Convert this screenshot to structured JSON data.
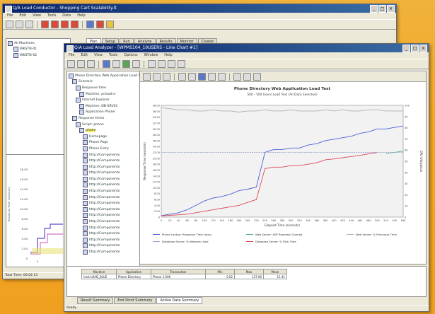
{
  "back_window": {
    "title": "Q/A Load Conductor - Shopping Cart Scalability.lt",
    "menu": [
      "File",
      "Edit",
      "View",
      "Tools",
      "Data",
      "Help"
    ],
    "tabs": [
      "Plan",
      "Setup",
      "Run",
      "Analyze",
      "Results",
      "Monitor",
      "Cluster"
    ],
    "tree": [
      "All Machines",
      "WKSTN-01",
      "WKSTN-02"
    ],
    "stats_label": "Total Time: 00:02:13",
    "mini_chart": {
      "ylabel": "Response Time (seconds)",
      "yticks": [
        "18.00",
        "16.00",
        "14.00",
        "12.00",
        "10.00",
        "8.00",
        "6.00",
        "4.00",
        "2.00",
        "0"
      ],
      "xtick": "0"
    }
  },
  "front_window": {
    "title": "Q/A Load Analyzer - [WPMS104_10USERS - Line Chart #1]",
    "menu": [
      "File",
      "Edit",
      "View",
      "Tools",
      "Options",
      "Window",
      "Help"
    ],
    "tree": [
      "Phone Directory Web Application Load Test",
      "Scenario",
      "Response time",
      "Machine: pcload-a",
      "Internet Explorer",
      "Machine: DB-SRV01",
      "Application Phone",
      "Response times",
      "Script: phone",
      "phone",
      "Homepage",
      "Phone Page",
      "Phone Entry",
      "http://Componentx",
      "http://Componentx",
      "http://Componentx",
      "http://Componentx",
      "http://Componentx",
      "http://Componentx",
      "http://Componentx",
      "http://Componentx",
      "http://Componentx",
      "http://Componentx",
      "http://Componentx",
      "http://Componentx",
      "http://Componentx",
      "http://Componentx",
      "http://Componentx",
      "http://Componentx",
      "http://Componentx"
    ],
    "bottom_tabs": [
      "Result Summary",
      "End Point Summary",
      "Active Data Summary"
    ],
    "table": {
      "headers": [
        "Machine",
        "Application",
        "Transaction",
        "Min",
        "Max",
        "Mean"
      ],
      "rows": [
        [
          "host-LOAD_BLUE",
          "Phone Directory",
          "Phone 1:500",
          "0.02",
          "137.06",
          "11.41"
        ]
      ]
    },
    "status": "Ready"
  },
  "chart_data": {
    "type": "line",
    "title": "Phone Directory Web Application Load Test",
    "subtitle": "500 - 500 Users Load Test (All Data Selected)",
    "xlabel": "Elapsed Time (seconds)",
    "ylabel": "Response Time (seconds)",
    "y2label": "CPU Utilization",
    "x": [
      0,
      20,
      40,
      60,
      80,
      100,
      120,
      140,
      160,
      180,
      200,
      220,
      240,
      260,
      280,
      300,
      320,
      340,
      360,
      380,
      400,
      420,
      440,
      460,
      480,
      500,
      520,
      540,
      560
    ],
    "ylim": [
      0,
      38
    ],
    "y2lim": [
      0,
      100
    ],
    "yticks": [
      "38.00",
      "36.00",
      "34.00",
      "32.00",
      "30.00",
      "28.00",
      "26.00",
      "24.00",
      "22.00",
      "20.00",
      "18.00",
      "16.00",
      "14.00",
      "12.00",
      "10.00",
      "8.00",
      "6.00",
      "4.00",
      "2.00",
      "0"
    ],
    "y2ticks": [
      "100",
      "90",
      "80",
      "70",
      "60",
      "50",
      "40",
      "30",
      "20",
      "10",
      "0"
    ],
    "xticks": [
      "0",
      "20",
      "40",
      "60",
      "80",
      "100",
      "120",
      "140",
      "160",
      "180",
      "200",
      "220",
      "240",
      "260",
      "280",
      "300",
      "320",
      "340",
      "360",
      "380",
      "400",
      "420",
      "440",
      "460",
      "480",
      "500",
      "520",
      "540",
      "560"
    ],
    "series": [
      {
        "name": "Phone Lookup: Response Time (secs)",
        "color": "#4a5fd6",
        "axis": "left",
        "values": [
          0.5,
          1.0,
          1.5,
          2.5,
          4.0,
          5.5,
          6.5,
          7.0,
          7.8,
          9.0,
          9.5,
          10.2,
          22.0,
          23.0,
          23.0,
          23.5,
          23.5,
          24.5,
          25.0,
          26.0,
          26.5,
          27.0,
          27.5,
          28.5,
          29.0,
          30.0,
          30.0,
          30.5,
          31.0
        ]
      },
      {
        "name": "Database Server: % Disk Time",
        "color": "#d94a55",
        "axis": "left",
        "values": [
          0.4,
          0.6,
          0.8,
          1.0,
          1.5,
          2.0,
          2.5,
          3.0,
          3.5,
          4.0,
          5.0,
          6.0,
          16.5,
          17.0,
          17.0,
          17.5,
          17.5,
          18.0,
          18.5,
          19.5,
          19.8,
          20.2,
          20.6,
          21.0,
          21.5,
          22.0,
          null,
          null,
          null
        ]
      },
      {
        "name": "Web Server: ASP Requests Queued",
        "color": "#5aa8a0",
        "axis": "right",
        "values": [
          null,
          null,
          null,
          null,
          null,
          null,
          null,
          null,
          null,
          null,
          null,
          null,
          null,
          null,
          null,
          null,
          null,
          null,
          null,
          null,
          null,
          null,
          null,
          null,
          null,
          null,
          57,
          58,
          59
        ]
      },
      {
        "name": "Web Server: % Processor Time",
        "color": "#aab4aa",
        "axis": "right",
        "values": [
          98,
          97,
          96,
          96,
          95,
          95,
          96,
          95,
          95,
          94,
          95,
          95,
          96,
          95,
          95,
          96,
          95,
          95,
          95,
          96,
          95,
          96,
          95,
          95,
          96,
          96,
          95,
          95,
          95
        ]
      },
      {
        "name": "Database Server: % Network Used",
        "color": "#9aa6c8",
        "axis": "right",
        "values": [
          58,
          58,
          58,
          58,
          58,
          58,
          58,
          58,
          58,
          58,
          58,
          58,
          58,
          58,
          58,
          58,
          58,
          58,
          58,
          58,
          58,
          58,
          58,
          58,
          58,
          58,
          58,
          58,
          58
        ]
      }
    ],
    "legend": [
      "Phone Lookup: Response Time (secs)",
      "Web Server: ASP Requests Queued",
      "Web Server: % Processor Time",
      "Database Server: % Network Used",
      "Database Server: % Disk Time"
    ],
    "legend_position": "bottom",
    "grid": false
  }
}
